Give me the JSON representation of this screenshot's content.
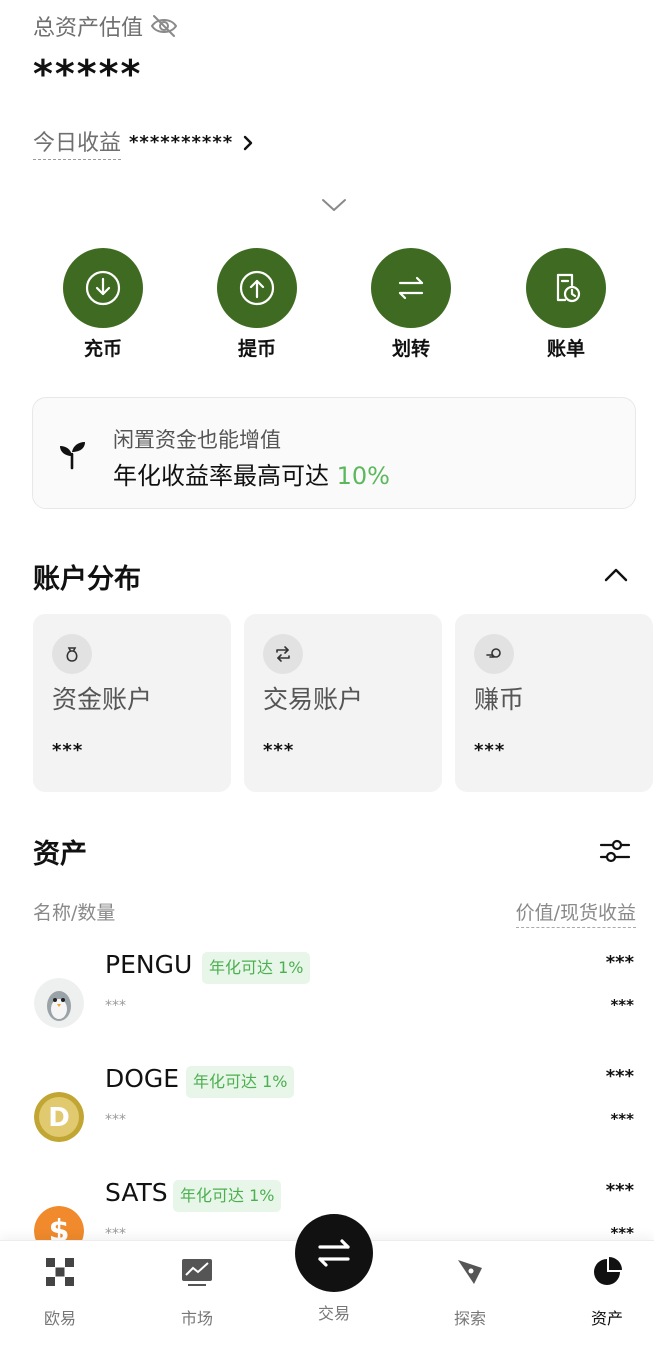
{
  "header": {
    "total_assets_label": "总资产估值",
    "total_assets_value": "*****",
    "today_label": "今日收益",
    "today_value": "**********"
  },
  "actions": [
    {
      "label": "充币",
      "icon": "deposit-icon"
    },
    {
      "label": "提币",
      "icon": "withdraw-icon"
    },
    {
      "label": "划转",
      "icon": "transfer-icon"
    },
    {
      "label": "账单",
      "icon": "bill-icon"
    }
  ],
  "promo": {
    "line1": "闲置资金也能增值",
    "line2_prefix": "年化收益率最高可达 ",
    "line2_highlight": "10%"
  },
  "accounts_section": {
    "title": "账户分布",
    "items": [
      {
        "name": "资金账户",
        "value": "***"
      },
      {
        "name": "交易账户",
        "value": "***"
      },
      {
        "name": "赚币",
        "value": "***"
      }
    ]
  },
  "assets_section": {
    "title": "资产",
    "col_left": "名称/数量",
    "col_right": "价值/现货收益",
    "items": [
      {
        "symbol": "PENGU",
        "badge": "年化可达 1%",
        "qty": "***",
        "value": "***",
        "pnl": "***"
      },
      {
        "symbol": "DOGE",
        "badge": "年化可达 1%",
        "qty": "***",
        "value": "***",
        "pnl": "***"
      },
      {
        "symbol": "SATS",
        "badge": "年化可达 1%",
        "qty": "***",
        "value": "***",
        "pnl": "***"
      }
    ]
  },
  "tabbar": {
    "tabs": [
      {
        "label": "欧易"
      },
      {
        "label": "市场"
      },
      {
        "label": "交易"
      },
      {
        "label": "探索"
      },
      {
        "label": "资产"
      }
    ]
  },
  "colors": {
    "action_green": "#3e6b21",
    "highlight_green": "#5cb85c",
    "badge_bg": "#e8f6e9"
  }
}
